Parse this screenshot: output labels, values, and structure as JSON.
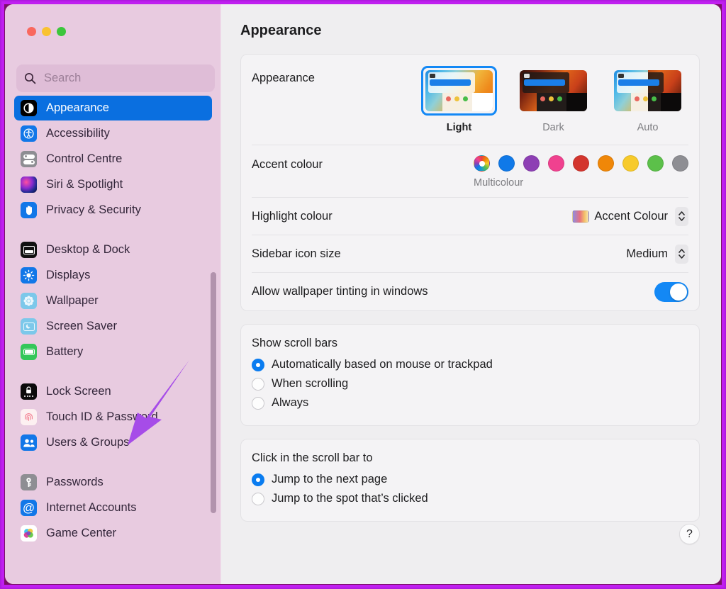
{
  "window": {
    "traffic_lights": [
      "close",
      "minimize",
      "zoom"
    ]
  },
  "search": {
    "placeholder": "Search",
    "value": "",
    "icon": "search-icon"
  },
  "sidebar": {
    "groups": [
      {
        "items": [
          {
            "label": "Appearance",
            "icon": "appearance-icon",
            "selected": true
          },
          {
            "label": "Accessibility",
            "icon": "accessibility-icon",
            "selected": false
          },
          {
            "label": "Control Centre",
            "icon": "control-centre-icon",
            "selected": false
          },
          {
            "label": "Siri & Spotlight",
            "icon": "siri-spotlight-icon",
            "selected": false
          },
          {
            "label": "Privacy & Security",
            "icon": "privacy-security-icon",
            "selected": false
          }
        ]
      },
      {
        "items": [
          {
            "label": "Desktop & Dock",
            "icon": "desktop-dock-icon",
            "selected": false
          },
          {
            "label": "Displays",
            "icon": "displays-icon",
            "selected": false
          },
          {
            "label": "Wallpaper",
            "icon": "wallpaper-icon",
            "selected": false
          },
          {
            "label": "Screen Saver",
            "icon": "screen-saver-icon",
            "selected": false
          },
          {
            "label": "Battery",
            "icon": "battery-icon",
            "selected": false
          }
        ]
      },
      {
        "items": [
          {
            "label": "Lock Screen",
            "icon": "lock-screen-icon",
            "selected": false
          },
          {
            "label": "Touch ID & Password",
            "icon": "touch-id-icon",
            "selected": false
          },
          {
            "label": "Users & Groups",
            "icon": "users-groups-icon",
            "selected": false
          }
        ]
      },
      {
        "items": [
          {
            "label": "Passwords",
            "icon": "passwords-icon",
            "selected": false
          },
          {
            "label": "Internet Accounts",
            "icon": "internet-accounts-icon",
            "selected": false
          },
          {
            "label": "Game Center",
            "icon": "game-center-icon",
            "selected": false
          }
        ]
      }
    ]
  },
  "detail": {
    "title": "Appearance",
    "appearance": {
      "label": "Appearance",
      "options": [
        {
          "name": "Light",
          "selected": true
        },
        {
          "name": "Dark",
          "selected": false
        },
        {
          "name": "Auto",
          "selected": false
        }
      ]
    },
    "accent": {
      "label": "Accent colour",
      "caption": "Multicolour",
      "swatches": [
        {
          "name": "multicolour",
          "color": "multicolour",
          "selected": true
        },
        {
          "name": "blue",
          "color": "#1079e8",
          "selected": false
        },
        {
          "name": "purple",
          "color": "#8d3fb4",
          "selected": false
        },
        {
          "name": "pink",
          "color": "#f0418f",
          "selected": false
        },
        {
          "name": "red",
          "color": "#d3352e",
          "selected": false
        },
        {
          "name": "orange",
          "color": "#f08708",
          "selected": false
        },
        {
          "name": "yellow",
          "color": "#f7ca2a",
          "selected": false
        },
        {
          "name": "green",
          "color": "#5cc04a",
          "selected": false
        },
        {
          "name": "graphite",
          "color": "#8e8e93",
          "selected": false
        }
      ]
    },
    "highlight": {
      "label": "Highlight colour",
      "value": "Accent Colour"
    },
    "sidebar_icon_size": {
      "label": "Sidebar icon size",
      "value": "Medium"
    },
    "wallpaper_tinting": {
      "label": "Allow wallpaper tinting in windows",
      "enabled": true
    },
    "show_scroll_bars": {
      "title": "Show scroll bars",
      "options": [
        {
          "label": "Automatically based on mouse or trackpad",
          "selected": true
        },
        {
          "label": "When scrolling",
          "selected": false
        },
        {
          "label": "Always",
          "selected": false
        }
      ]
    },
    "scroll_bar_click": {
      "title": "Click in the scroll bar to",
      "options": [
        {
          "label": "Jump to the next page",
          "selected": true
        },
        {
          "label": "Jump to the spot that’s clicked",
          "selected": false
        }
      ]
    },
    "help_label": "?"
  },
  "annotation": {
    "arrow_color": "#a64ce8",
    "points_to": "Users & Groups"
  },
  "colors": {
    "accent_blue": "#0a6fe0",
    "sidebar_bg": "#e8cbe0",
    "detail_bg": "#efeef0",
    "frame": "#b01ae0"
  }
}
